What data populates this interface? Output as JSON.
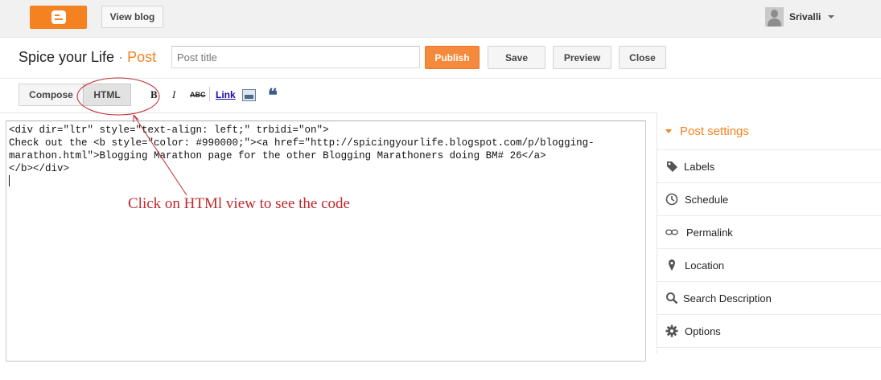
{
  "topbar": {
    "view_blog": "View blog",
    "user_name": "Srivalli"
  },
  "titlebar": {
    "blog_name": "Spice your Life",
    "separator": "·",
    "post_word": "Post",
    "title_placeholder": "Post title",
    "publish": "Publish",
    "save": "Save",
    "preview": "Preview",
    "close": "Close"
  },
  "toolbar": {
    "compose": "Compose",
    "html": "HTML",
    "bold": "B",
    "italic": "I",
    "strike": "ABC",
    "link": "Link",
    "quote": "❝"
  },
  "editor": {
    "code": "<div dir=\"ltr\" style=\"text-align: left;\" trbidi=\"on\">\nCheck out the <b style=\"color: #990000;\"><a href=\"http://spicingyourlife.blogspot.com/p/blogging-\nmarathon.html\">Blogging Marathon page for the other Blogging Marathoners doing BM# 26</a>\n</b></div>",
    "annotation": "Click on HTMl view to see the code"
  },
  "sidebar": {
    "header": "Post settings",
    "items": [
      {
        "label": "Labels",
        "icon": "tag-icon"
      },
      {
        "label": "Schedule",
        "icon": "clock-icon"
      },
      {
        "label": "Permalink",
        "icon": "link-icon"
      },
      {
        "label": "Location",
        "icon": "pin-icon"
      },
      {
        "label": "Search Description",
        "icon": "search-icon"
      },
      {
        "label": "Options",
        "icon": "gear-icon"
      }
    ]
  },
  "colors": {
    "accent": "#f58220",
    "annotation": "#c0282d"
  }
}
